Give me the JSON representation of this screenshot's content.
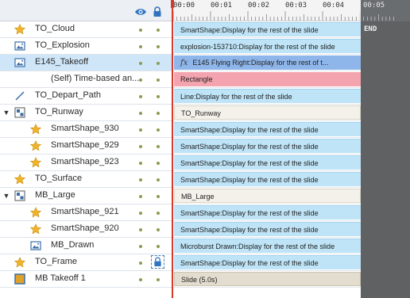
{
  "ruler": {
    "ticks": [
      "00:00",
      "00:01",
      "00:02",
      "00:03",
      "00:04",
      "00:05"
    ]
  },
  "end_label": "END",
  "layers": [
    {
      "label": "TO_Cloud",
      "icon": "star-icon",
      "bar": "SmartShape:Display for the rest of the slide",
      "bar_style": "blue",
      "indent": 0,
      "expander": ""
    },
    {
      "label": "TO_Explosion",
      "icon": "image-icon",
      "bar": "explosion-153710:Display for the rest of the slide",
      "bar_style": "blue",
      "indent": 0,
      "expander": ""
    },
    {
      "label": "E145_Takeoff",
      "icon": "image-icon",
      "bar": "E145 Flying Right:Display for the rest of t...",
      "bar_style": "sel",
      "indent": 0,
      "expander": "",
      "fx": "fx",
      "selected": true
    },
    {
      "label": "(Self) Time-based an...",
      "icon": "",
      "bar": "Rectangle",
      "bar_style": "pink",
      "indent": 1,
      "expander": ""
    },
    {
      "label": "TO_Depart_Path",
      "icon": "line-icon",
      "bar": "Line:Display for the rest of the slide",
      "bar_style": "blue",
      "indent": 0,
      "expander": ""
    },
    {
      "label": "TO_Runway",
      "icon": "group-icon",
      "bar": "TO_Runway",
      "bar_style": "light",
      "indent": 0,
      "expander": "▼"
    },
    {
      "label": "SmartShape_930",
      "icon": "star-icon",
      "bar": "SmartShape:Display for the rest of the slide",
      "bar_style": "blue",
      "indent": 1,
      "expander": ""
    },
    {
      "label": "SmartShape_929",
      "icon": "star-icon",
      "bar": "SmartShape:Display for the rest of the slide",
      "bar_style": "blue",
      "indent": 1,
      "expander": ""
    },
    {
      "label": "SmartShape_923",
      "icon": "star-icon",
      "bar": "SmartShape:Display for the rest of the slide",
      "bar_style": "blue",
      "indent": 1,
      "expander": ""
    },
    {
      "label": "TO_Surface",
      "icon": "star-icon",
      "bar": "SmartShape:Display for the rest of the slide",
      "bar_style": "blue",
      "indent": 0,
      "expander": ""
    },
    {
      "label": "MB_Large",
      "icon": "group-icon",
      "bar": "MB_Large",
      "bar_style": "light",
      "indent": 0,
      "expander": "▼"
    },
    {
      "label": "SmartShape_921",
      "icon": "star-icon",
      "bar": "SmartShape:Display for the rest of the slide",
      "bar_style": "blue",
      "indent": 1,
      "expander": ""
    },
    {
      "label": "SmartShape_920",
      "icon": "star-icon",
      "bar": "SmartShape:Display for the rest of the slide",
      "bar_style": "blue",
      "indent": 1,
      "expander": ""
    },
    {
      "label": "MB_Drawn",
      "icon": "image-icon",
      "bar": "Microburst Drawn:Display for the rest of the slide",
      "bar_style": "blue",
      "indent": 1,
      "expander": ""
    },
    {
      "label": "TO_Frame",
      "icon": "star-icon",
      "bar": "SmartShape:Display for the rest of the slide",
      "bar_style": "blue",
      "indent": 0,
      "expander": "",
      "locked": true
    },
    {
      "label": "MB Takeoff 1",
      "icon": "slide-icon",
      "bar": "Slide (5.0s)",
      "bar_style": "beige",
      "indent": 0,
      "expander": ""
    }
  ],
  "colors": {
    "accent": "#d63a2a",
    "bar_blue": "#bfe4f7",
    "bar_selected": "#8fb6ea",
    "bar_pink": "#f4a4ae",
    "star": "#f0b429"
  }
}
